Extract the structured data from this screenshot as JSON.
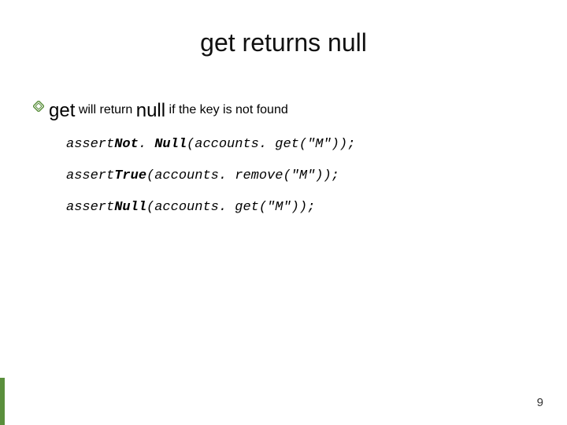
{
  "title": {
    "word_get": "get",
    "middle": " returns ",
    "word_null": "null"
  },
  "bullet": {
    "icon": "diamond-bullet-icon",
    "word_get": "get",
    "mid1": " will return ",
    "word_null": "null",
    "mid2": " if the key is not found"
  },
  "code": {
    "line1": {
      "a": "assert",
      "b": "Not",
      "c": ". ",
      "d": "Null",
      "e": "(accounts. get(\"M\"));"
    },
    "line2": {
      "a": "assert",
      "b": "True",
      "c": "(accounts. remove(\"M\"));"
    },
    "line3": {
      "a": "assert",
      "b": "Null",
      "c": "(accounts. get(\"M\"));"
    }
  },
  "page_number": "9"
}
